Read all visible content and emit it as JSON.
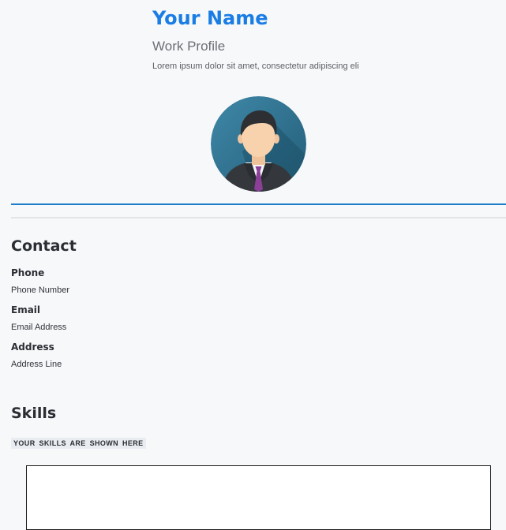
{
  "profile": {
    "name": "Your Name",
    "title": "Work Profile",
    "tagline": "Lorem ipsum dolor sit amet, consectetur adipiscing eli"
  },
  "avatar": {
    "icon": "person-avatar-icon",
    "background_color": "#2f6f8f",
    "tie_color": "#8b3f97"
  },
  "contact": {
    "heading": "Contact",
    "items": [
      {
        "label": "Phone",
        "value": "Phone Number"
      },
      {
        "label": "Email",
        "value": "Email Address"
      },
      {
        "label": "Address",
        "value": "Address Line"
      }
    ]
  },
  "skills": {
    "heading": "Skills",
    "chip": "YOUR SKILLS ARE SHOWN HERE"
  },
  "colors": {
    "accent": "#1a7de4",
    "divider": "#1f7cc8"
  }
}
